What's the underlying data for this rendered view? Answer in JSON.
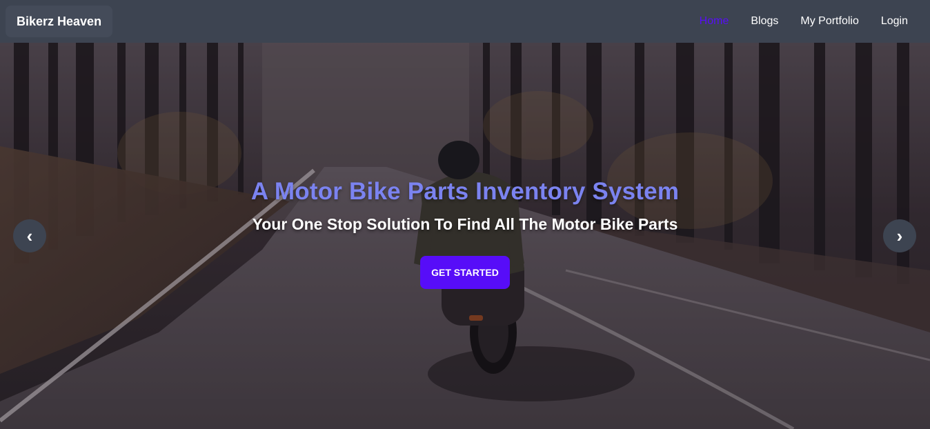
{
  "navbar": {
    "brand": "Bikerz Heaven",
    "links": [
      {
        "label": "Home",
        "active": true
      },
      {
        "label": "Blogs",
        "active": false
      },
      {
        "label": "My Portfolio",
        "active": false
      },
      {
        "label": "Login",
        "active": false
      }
    ]
  },
  "hero": {
    "title": "A Motor Bike Parts Inventory System",
    "subtitle": "Your One Stop Solution To Find All The Motor Bike Parts",
    "cta_label": "GET STARTED",
    "prev_icon": "chevron-left-icon",
    "next_icon": "chevron-right-icon",
    "prev_glyph": "‹",
    "next_glyph": "›",
    "background_image": "motorcycle rider on a forest road"
  },
  "colors": {
    "navbar_bg": "#3d4451",
    "accent": "#570df8",
    "title": "#7b83f0",
    "text": "#ffffff"
  }
}
